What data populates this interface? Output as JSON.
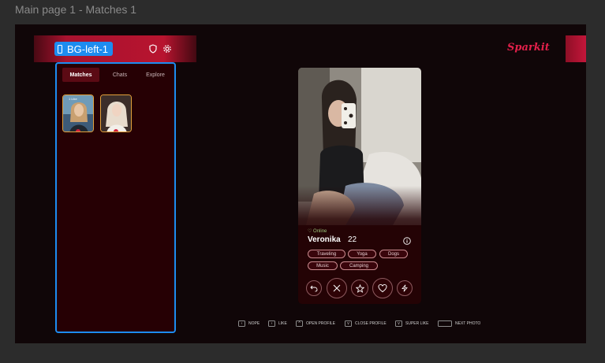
{
  "frame_title": "Main page 1 - Matches 1",
  "layer_label": "BG-left-1",
  "brand": "Sparkit",
  "tabs": [
    {
      "label": "Matches"
    },
    {
      "label": "Chats"
    },
    {
      "label": "Explore"
    }
  ],
  "matches": [
    {
      "badge": "1 Like"
    },
    {
      "badge": ""
    }
  ],
  "profile": {
    "status": "♡ Online",
    "name": "Veronika",
    "age": "22",
    "tags": [
      "Traveling",
      "Yoga",
      "Dogs",
      "Music",
      "Camping"
    ]
  },
  "hints": [
    {
      "key": "‹",
      "label": "NOPE"
    },
    {
      "key": "›",
      "label": "LIKE"
    },
    {
      "key": "^",
      "label": "OPEN PROFILE"
    },
    {
      "key": "v",
      "label": "CLOSE PROFILE"
    },
    {
      "key": "v",
      "label": "SUPER LIKE"
    },
    {
      "key": "",
      "label": "NEXT PHOTO"
    }
  ],
  "colors": {
    "accent": "#e2204a",
    "selection": "#1d8cf0",
    "panel": "#260004"
  }
}
